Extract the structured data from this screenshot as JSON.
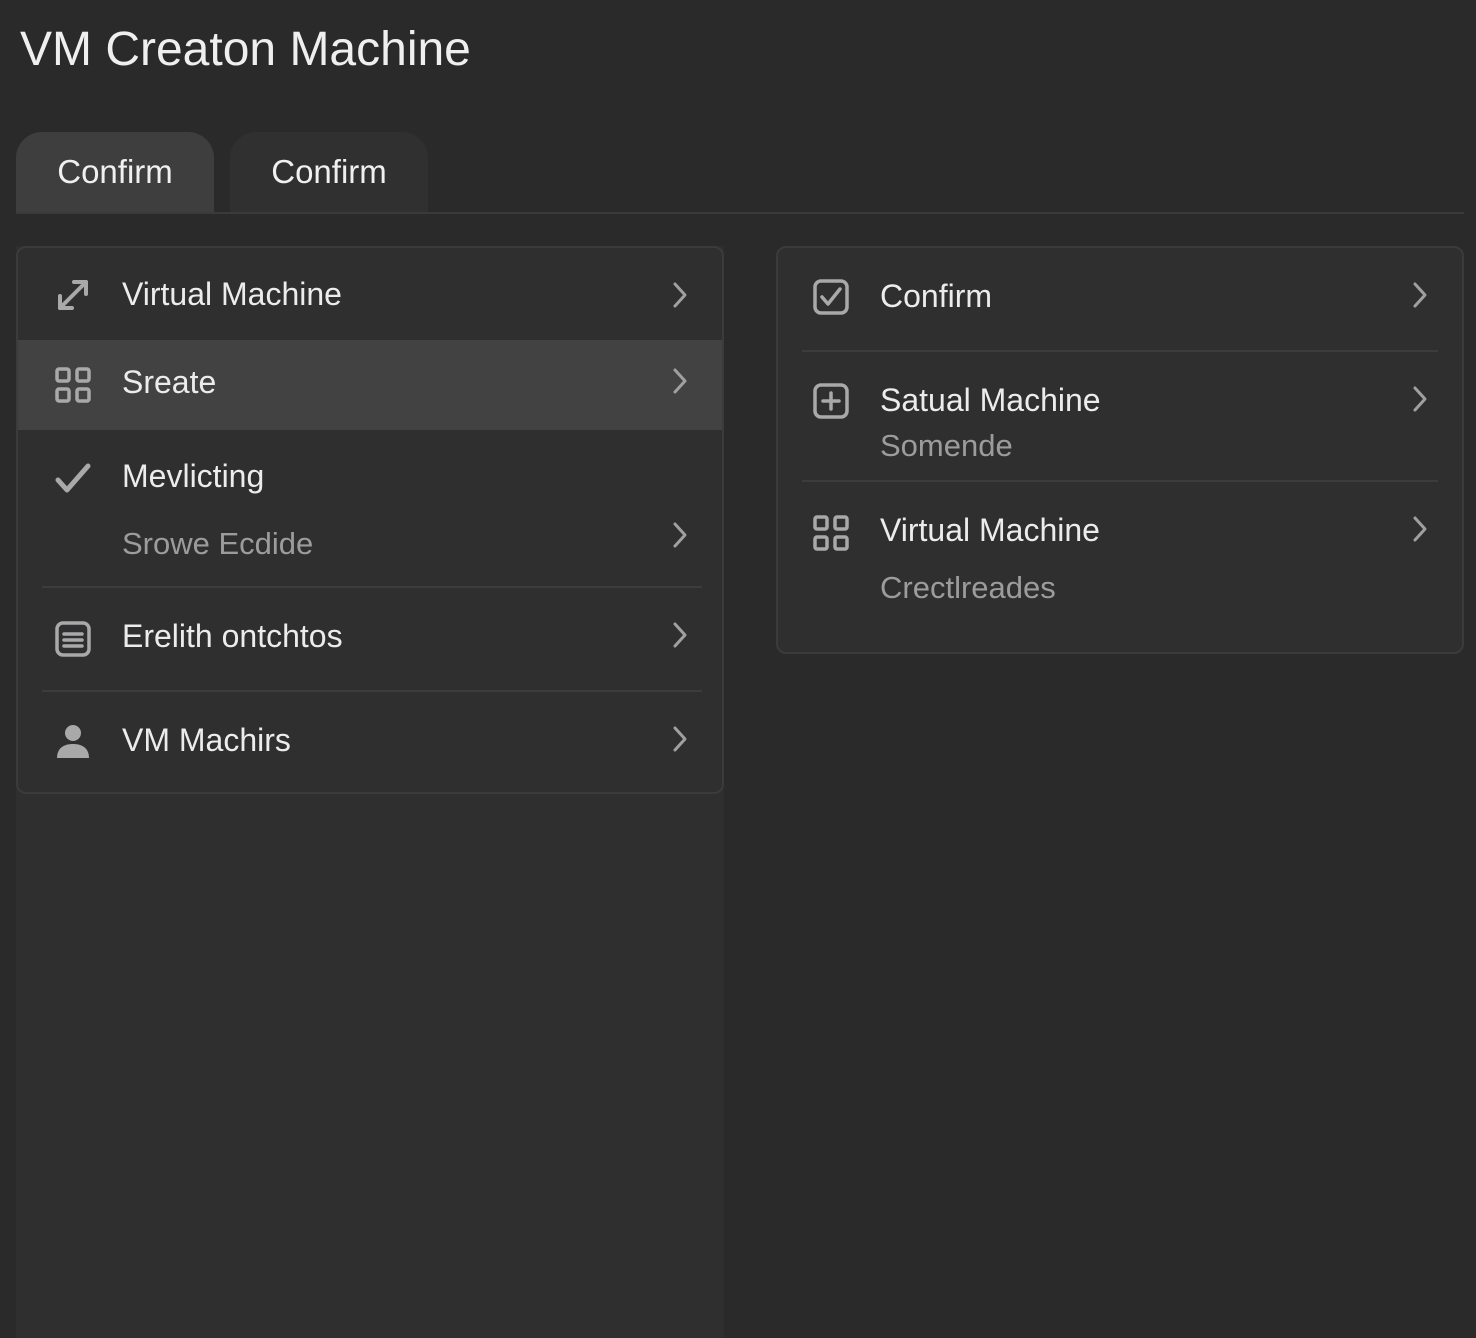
{
  "app": {
    "title": "VM Creaton Machine"
  },
  "tabs": [
    {
      "label": "Confirm",
      "icon": null
    },
    {
      "label": "Confirm",
      "icon": null
    }
  ],
  "left_list": {
    "items": [
      {
        "label": "Virtual Machine",
        "icon": "resize-arrow-icon"
      },
      {
        "label": "Sreate",
        "icon": "grid-icon",
        "selected": true
      },
      {
        "label": "Mevlicting",
        "sublabel": "Srowe Ecdide",
        "icon": "checkmark-icon"
      },
      {
        "label": "Erelith ontchtos",
        "icon": "document-icon"
      },
      {
        "label": "VM Machirs",
        "icon": "user-icon"
      }
    ]
  },
  "right_list": {
    "items": [
      {
        "label": "Confirm",
        "icon": "checkbox-icon"
      },
      {
        "label": "Satual Machine",
        "sublabel": "Somende",
        "icon": "plus-square-icon"
      },
      {
        "label": "Virtual Machine",
        "sublabel": "Crectlreades",
        "icon": "grid-icon"
      }
    ]
  },
  "colors": {
    "background": "#2a2a2b",
    "card": "#2f2f30",
    "selected_row": "#424243",
    "text_primary": "#ececec",
    "text_secondary": "#9c9c9d"
  }
}
